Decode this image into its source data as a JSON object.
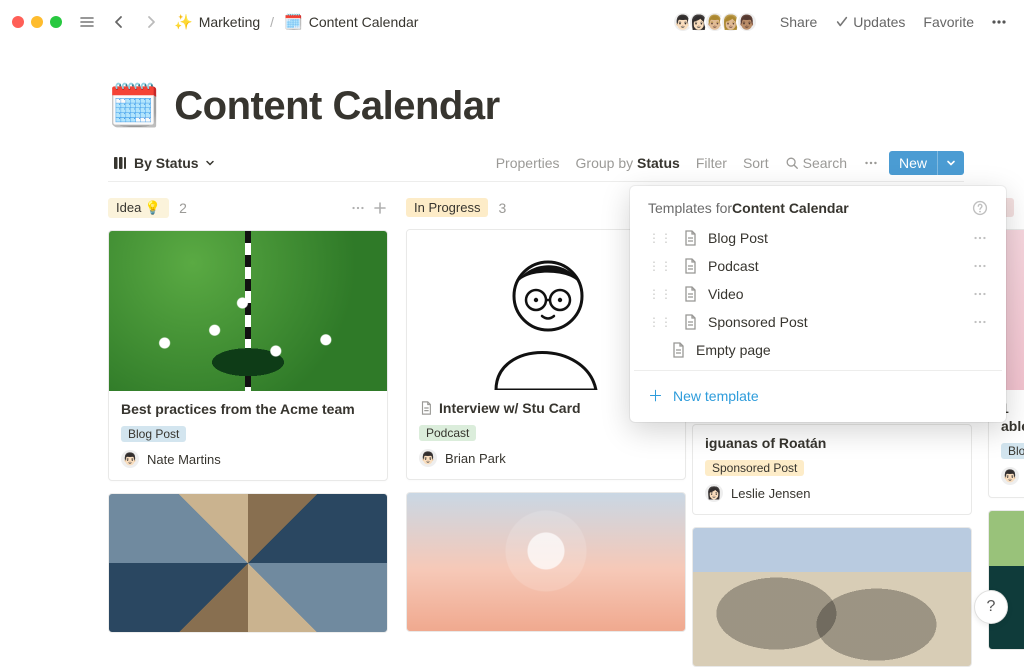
{
  "window": {
    "breadcrumb": [
      {
        "emoji": "✨",
        "label": "Marketing"
      },
      {
        "emoji": "🗓️",
        "label": "Content Calendar"
      }
    ],
    "actions": {
      "share": "Share",
      "updates": "Updates",
      "favorite": "Favorite"
    }
  },
  "page": {
    "emoji": "🗓️",
    "title": "Content Calendar"
  },
  "db_toolbar": {
    "view_name": "By Status",
    "properties": "Properties",
    "group_by_prefix": "Group by ",
    "group_by_value": "Status",
    "filter": "Filter",
    "sort": "Sort",
    "search": "Search",
    "new_label": "New"
  },
  "board": {
    "columns": [
      {
        "key": "idea",
        "label": "Idea 💡",
        "count": "2",
        "cards": [
          {
            "title": "Best practices from the Acme team",
            "tag": "Blog Post",
            "tag_cls": "pill-blue",
            "author": "Nate Martins",
            "author_glyph": "👨🏻",
            "cover_cls": "cv-golf",
            "show_page_icon": false
          }
        ],
        "strip_cover_cls": "cv-city"
      },
      {
        "key": "in_progress",
        "label": "In Progress",
        "count": "3",
        "cards": [
          {
            "title": "Interview w/ Stu Card",
            "tag": "Podcast",
            "tag_cls": "pill-green",
            "author": "Brian Park",
            "author_glyph": "👨🏻",
            "cover_svg": "stu",
            "show_page_icon": true
          }
        ],
        "strip_cover_cls": "cv-bulb"
      },
      {
        "key": "col3_partial",
        "partial": {
          "title_tail": "iguanas of Roatán",
          "tag": "Sponsored Post",
          "tag_cls": "pill-yellow",
          "author": "Leslie Jensen",
          "author_glyph": "👩🏻",
          "strip_cover_cls": "cv-gaudi"
        }
      },
      {
        "key": "col4_partial",
        "header_label_fragment": "bl",
        "partial": {
          "title_head": "1",
          "title_tail2": "able",
          "tag": "Blog",
          "author_glyph": "👨🏻",
          "author_initial": "N",
          "strip_cover_cls": "cv-lake",
          "cover_cls": "cv-pink"
        }
      }
    ]
  },
  "templates_popover": {
    "title_prefix": "Templates for ",
    "title_bold": "Content Calendar",
    "items": [
      {
        "label": "Blog Post",
        "draggable": true
      },
      {
        "label": "Podcast",
        "draggable": true
      },
      {
        "label": "Video",
        "draggable": true
      },
      {
        "label": "Sponsored Post",
        "draggable": true
      },
      {
        "label": "Empty page",
        "draggable": false
      }
    ],
    "new_template": "New template"
  },
  "help_bubble": "?"
}
